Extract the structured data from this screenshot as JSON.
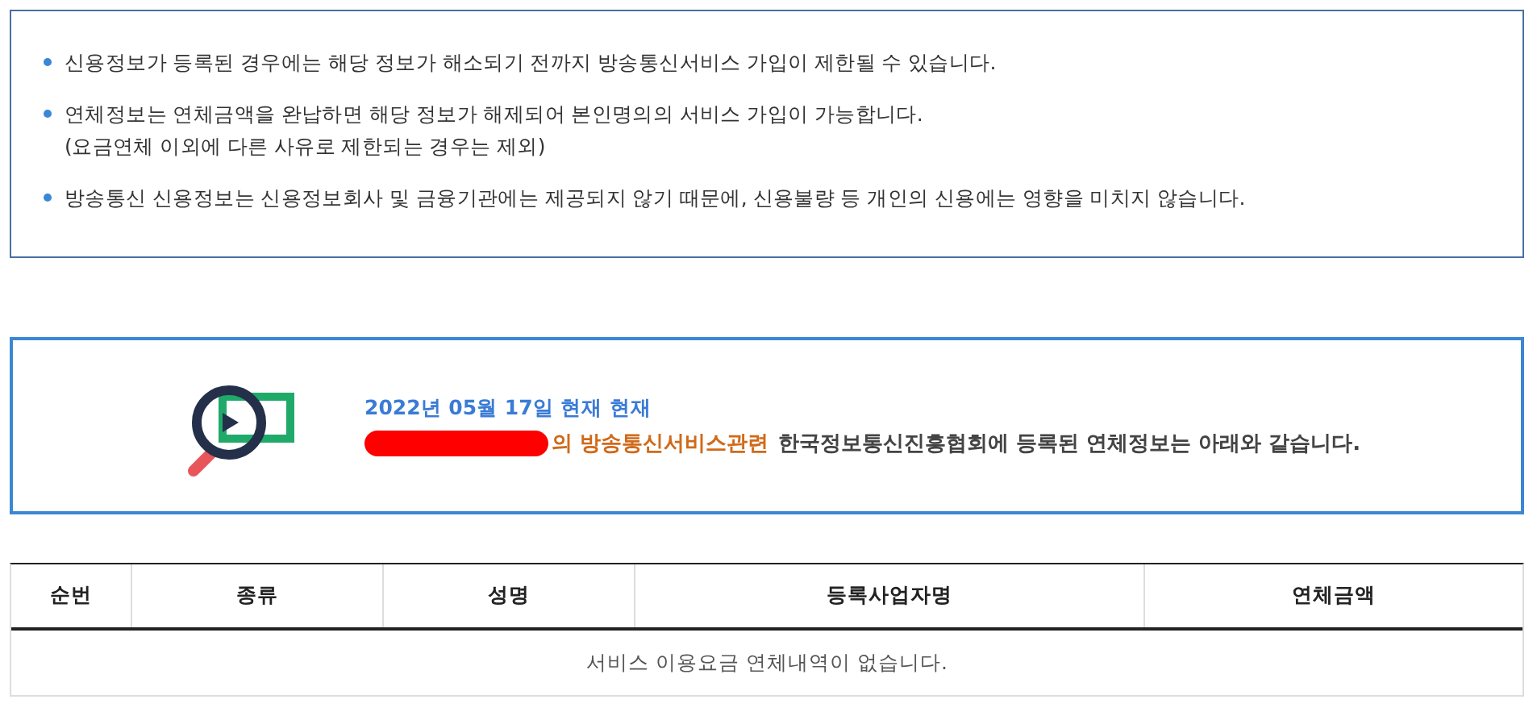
{
  "notice": {
    "items": [
      {
        "lines": [
          "신용정보가 등록된 경우에는 해당 정보가 해소되기 전까지 방송통신서비스 가입이 제한될 수 있습니다."
        ]
      },
      {
        "lines": [
          "연체정보는 연체금액을 완납하면 해당 정보가 해제되어 본인명의의 서비스 가입이 가능합니다.",
          "(요금연체 이외에 다른 사유로 제한되는 경우는 제외)"
        ]
      },
      {
        "lines": [
          "방송통신 신용정보는 신용정보회사 및 금융기관에는 제공되지 않기 때문에, 신용불량 등 개인의 신용에는 영향을 미치지 않습니다."
        ]
      }
    ]
  },
  "status": {
    "date": "2022년 05월 17일 현재 현재",
    "highlight": "의 방송통신서비스관련",
    "message": "한국정보통신진흥협회에 등록된 연체정보는 아래와 같습니다."
  },
  "table": {
    "columns": [
      "순번",
      "종류",
      "성명",
      "등록사업자명",
      "연체금액"
    ],
    "empty_message": "서비스 이용요금 연체내역이 없습니다."
  }
}
